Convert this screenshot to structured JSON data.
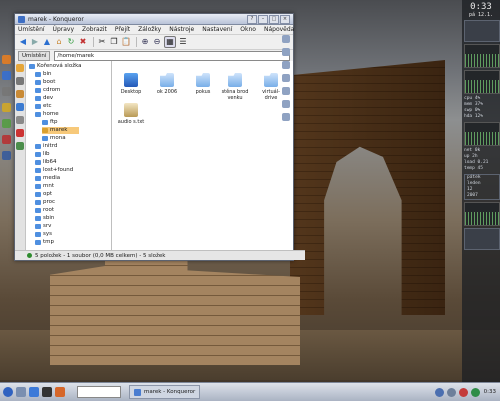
{
  "window": {
    "title": "marek - Konqueror",
    "menu": [
      "Umístění",
      "Úpravy",
      "Zobrazit",
      "Přejít",
      "Záložky",
      "Nástroje",
      "Nastavení",
      "Okno",
      "Nápověda"
    ],
    "up_label": "Umístění",
    "location_value": "/home/marek",
    "status_text": "5 položek - 1 soubor (0,0 MB celkem) - 5 složek"
  },
  "toolbar_icons": [
    "back-icon",
    "forward-icon",
    "up-icon",
    "home-icon",
    "reload-icon",
    "stop-icon",
    "cut-icon",
    "copy-icon",
    "paste-icon",
    "zoom-in-icon",
    "zoom-out-icon",
    "icon-view-icon",
    "detail-view-icon"
  ],
  "tree": {
    "root": "Kořenová složka",
    "items": [
      {
        "label": "bin"
      },
      {
        "label": "boot"
      },
      {
        "label": "cdrom"
      },
      {
        "label": "dev"
      },
      {
        "label": "etc"
      },
      {
        "label": "home"
      },
      {
        "label": "ftp"
      },
      {
        "label": "marek",
        "selected": true
      },
      {
        "label": "mona"
      },
      {
        "label": "initrd"
      },
      {
        "label": "lib"
      },
      {
        "label": "lib64"
      },
      {
        "label": "lost+found"
      },
      {
        "label": "media"
      },
      {
        "label": "mnt"
      },
      {
        "label": "opt"
      },
      {
        "label": "proc"
      },
      {
        "label": "root"
      },
      {
        "label": "sbin"
      },
      {
        "label": "srv"
      },
      {
        "label": "sys"
      },
      {
        "label": "tmp"
      },
      {
        "label": "usr"
      },
      {
        "label": "var"
      }
    ]
  },
  "content": {
    "items": [
      {
        "label": "Desktop",
        "icon": "desktop-folder-icon"
      },
      {
        "label": "ok 2006",
        "icon": "folder-icon"
      },
      {
        "label": "pokus",
        "icon": "folder-icon"
      },
      {
        "label": "stěna brod venku",
        "icon": "folder-icon"
      },
      {
        "label": "virtuál-drive",
        "icon": "folder-icon"
      },
      {
        "label": "audio s.txt",
        "icon": "file-icon"
      }
    ]
  },
  "side_panel": {
    "clock_time": "0:33",
    "clock_date": "pá 12.1.",
    "stats": [
      "cpu 4%",
      "mem 37%",
      "swp 0%",
      "hda 12%",
      "net 0k",
      "up 2h",
      "load 0.21",
      "temp 45"
    ],
    "box_lines": [
      "pátek",
      "leden",
      "12",
      "2007"
    ]
  },
  "taskbar": {
    "task_label": "marek - Konqueror",
    "clock": "0:33"
  },
  "colors": {
    "selection": "#f7c97a",
    "titlebar": "#b9c3d8",
    "taskbar": "#aab3c3"
  }
}
